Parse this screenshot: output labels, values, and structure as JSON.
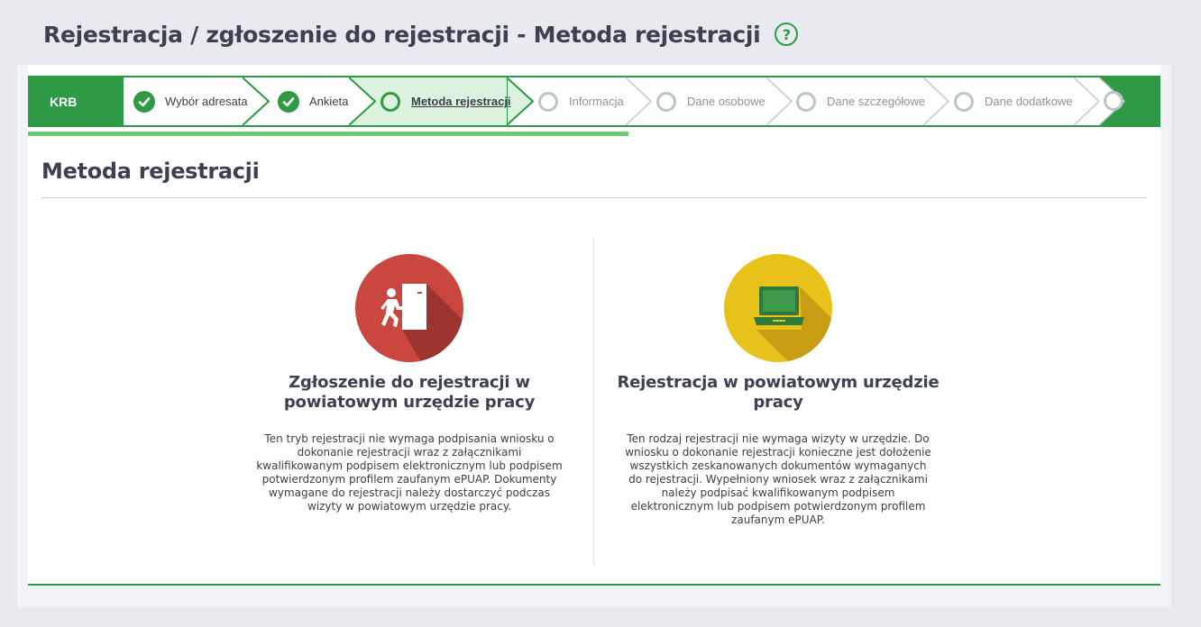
{
  "page": {
    "title": "Rejestracja / zgłoszenie do rejestracji - Metoda rejestracji",
    "help_icon": "question-circle-icon"
  },
  "stepper": {
    "root_label": "KRB",
    "steps": [
      {
        "label": "Wybór adresata",
        "state": "done"
      },
      {
        "label": "Ankieta",
        "state": "done"
      },
      {
        "label": "Metoda rejestracji",
        "state": "active"
      },
      {
        "label": "Informacja",
        "state": "future"
      },
      {
        "label": "Dane osobowe",
        "state": "future"
      },
      {
        "label": "Dane szczegółowe",
        "state": "future"
      },
      {
        "label": "Dane dodatkowe",
        "state": "future"
      }
    ],
    "progress_percent": 53
  },
  "section": {
    "title": "Metoda rejestracji"
  },
  "options": [
    {
      "icon": "person-entering-door-icon",
      "color": "#c9473f",
      "title": "Zgłoszenie do rejestracji w powiatowym urzędzie pracy",
      "description": "Ten tryb rejestracji nie wymaga podpisania wniosku o dokonanie rejestracji wraz z załącznikami kwalifikowanym podpisem elektronicznym lub podpisem potwierdzonym profilem zaufanym ePUAP. Dokumenty wymagane do rejestracji należy dostarczyć podczas wizyty w powiatowym urzędzie pracy."
    },
    {
      "icon": "laptop-icon",
      "color": "#e8c11b",
      "title": "Rejestracja w powiatowym urzędzie pracy",
      "description": "Ten rodzaj rejestracji nie wymaga wizyty w urzędzie. Do wniosku o dokonanie rejestracji konieczne jest dołożenie wszystkich zeskanowanych dokumentów wymaganych do rejestracji. Wypełniony wniosek wraz z załącznikami należy podpisać kwalifikowanym podpisem elektronicznym lub podpisem potwierdzonym profilem zaufanym ePUAP."
    }
  ],
  "colors": {
    "accent": "#2e9a45",
    "active_step_bg": "#dcf2de",
    "progress": "#6ccb77"
  }
}
